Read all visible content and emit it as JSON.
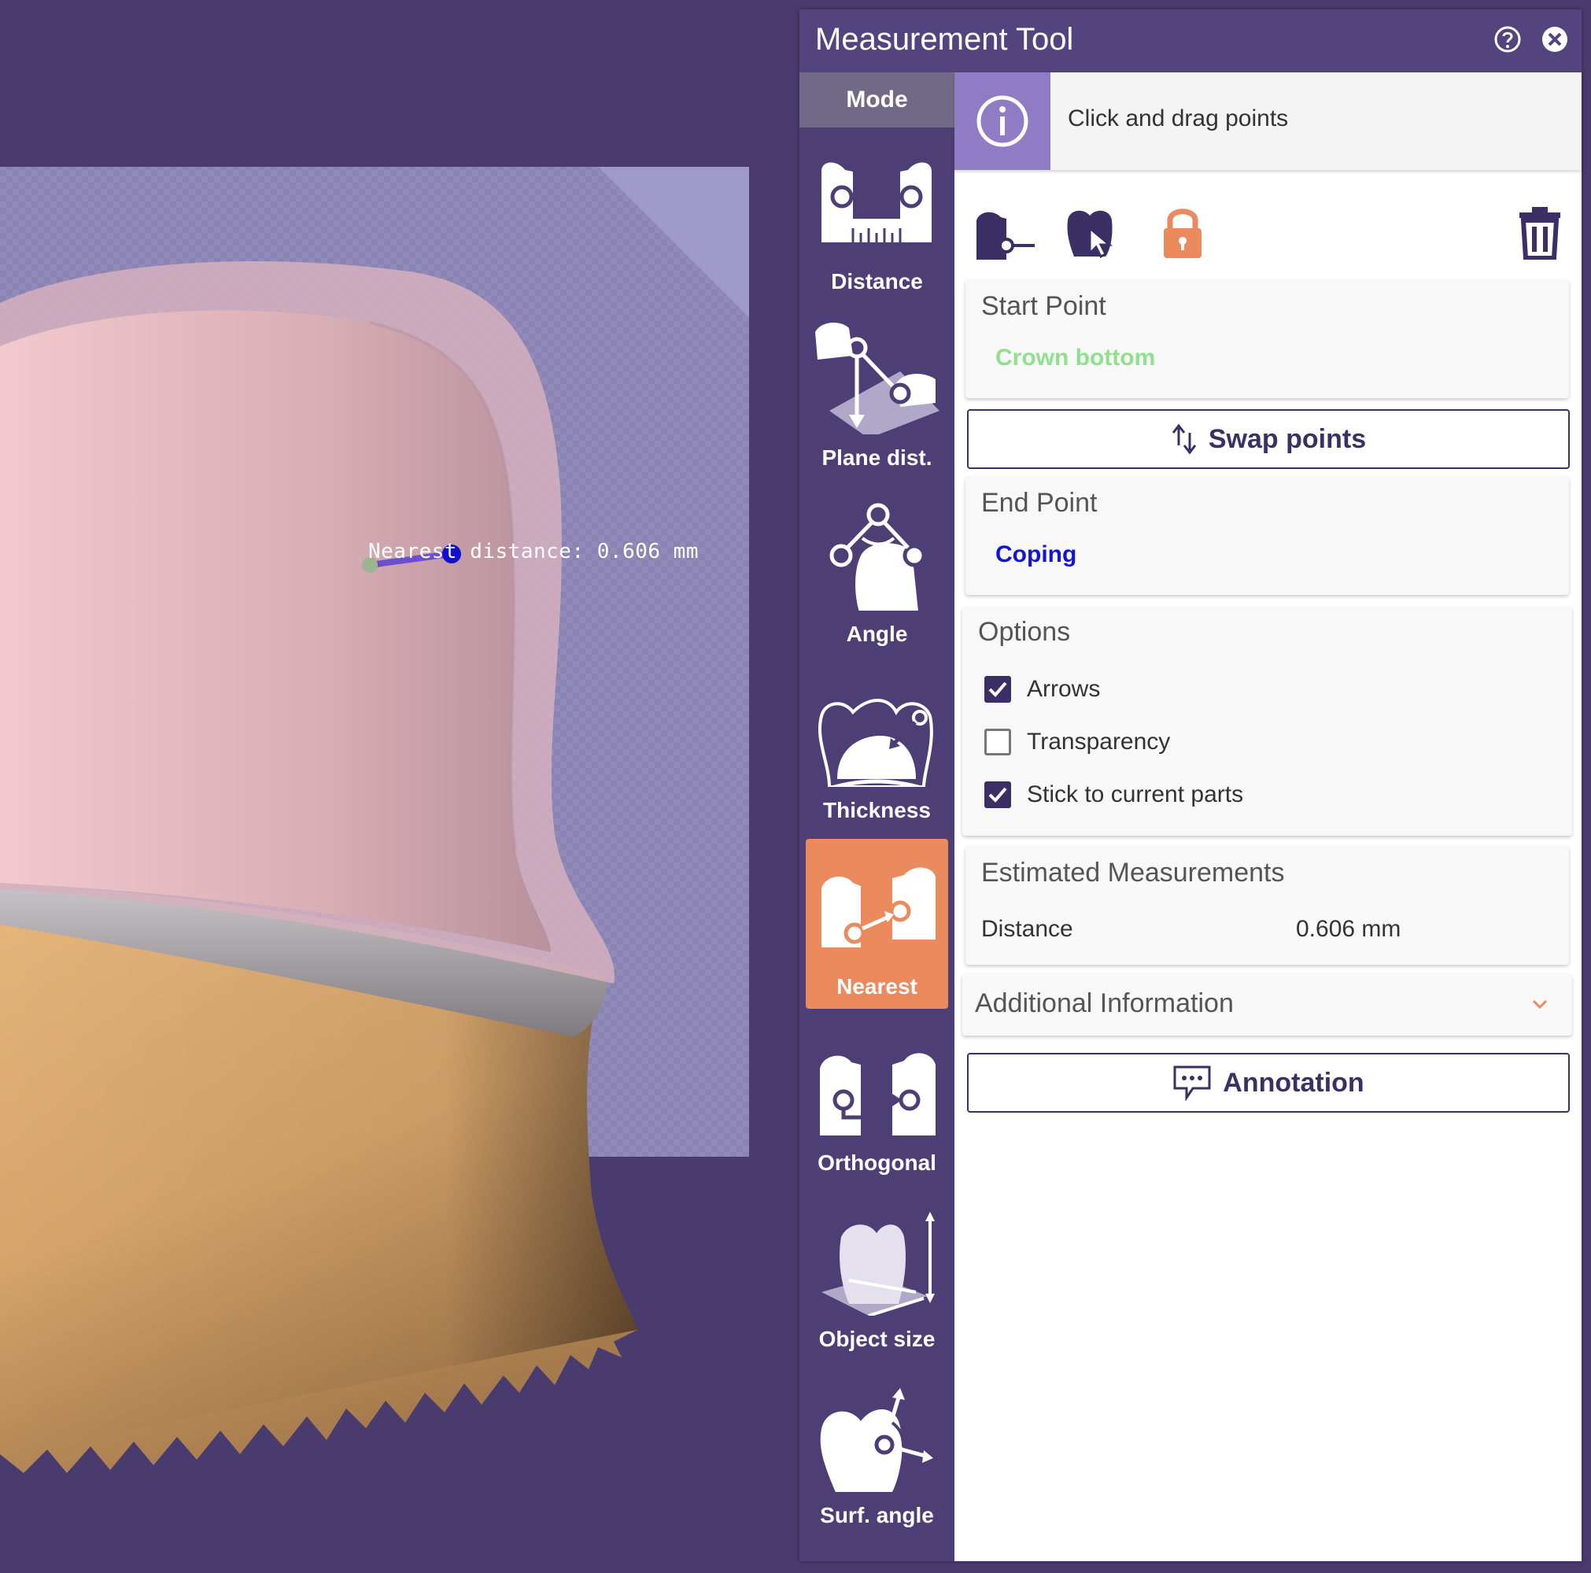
{
  "viewport": {
    "measure_label": "Nearest distance: 0.606 mm"
  },
  "panel": {
    "title": "Measurement Tool",
    "help_icon": "help-circle-icon",
    "close_icon": "close-circle-icon"
  },
  "mode": {
    "header": "Mode",
    "items": [
      {
        "label": "Distance",
        "icon": "distance-icon",
        "active": false
      },
      {
        "label": "Plane dist.",
        "icon": "plane-distance-icon",
        "active": false
      },
      {
        "label": "Angle",
        "icon": "angle-icon",
        "active": false
      },
      {
        "label": "Thickness",
        "icon": "thickness-icon",
        "active": false
      },
      {
        "label": "Nearest",
        "icon": "nearest-icon",
        "active": true
      },
      {
        "label": "Orthogonal",
        "icon": "orthogonal-icon",
        "active": false
      },
      {
        "label": "Object size",
        "icon": "object-size-icon",
        "active": false
      },
      {
        "label": "Surf. angle",
        "icon": "surface-angle-icon",
        "active": false
      }
    ]
  },
  "info": {
    "text": "Click and drag points",
    "icon": "info-icon"
  },
  "toolbar": {
    "icons": [
      "set-point-icon",
      "pick-object-icon",
      "lock-icon",
      "trash-icon"
    ],
    "lock_color": "#ea8a5d"
  },
  "start_point": {
    "title": "Start Point",
    "value": "Crown bottom",
    "color": "#8fe08f"
  },
  "swap_button": {
    "label": "Swap points"
  },
  "end_point": {
    "title": "End Point",
    "value": "Coping",
    "color": "#1414d8"
  },
  "options": {
    "title": "Options",
    "items": [
      {
        "label": "Arrows",
        "checked": true
      },
      {
        "label": "Transparency",
        "checked": false
      },
      {
        "label": "Stick to current parts",
        "checked": true
      }
    ]
  },
  "estimated": {
    "title": "Estimated Measurements",
    "rows": [
      {
        "name": "Distance",
        "value": "0.606 mm"
      }
    ]
  },
  "additional": {
    "title": "Additional Information"
  },
  "annotation_button": {
    "label": "Annotation"
  },
  "colors": {
    "background": "#4a3b6e",
    "titlebar": "#53447f",
    "accent": "#ea8a5d",
    "dark": "#3b2f66"
  }
}
